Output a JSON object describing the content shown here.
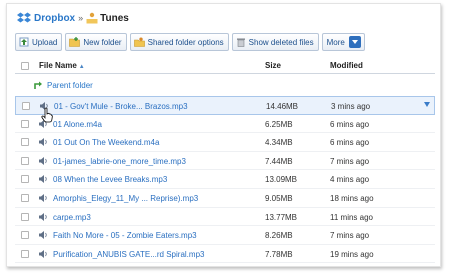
{
  "breadcrumb": {
    "root": "Dropbox",
    "separator": "»",
    "current": "Tunes"
  },
  "toolbar": {
    "upload": "Upload",
    "new_folder": "New folder",
    "shared_folder_options": "Shared folder options",
    "show_deleted_files": "Show deleted files",
    "more": "More"
  },
  "table": {
    "headers": {
      "name": "File Name",
      "size": "Size",
      "modified": "Modified"
    },
    "parent_folder": "Parent folder",
    "rows": [
      {
        "name": "01 - Gov't Mule - Broke... Brazos.mp3",
        "size": "14.46MB",
        "modified": "3 mins ago"
      },
      {
        "name": "01 Alone.m4a",
        "size": "6.25MB",
        "modified": "6 mins ago"
      },
      {
        "name": "01 Out On The Weekend.m4a",
        "size": "4.34MB",
        "modified": "6 mins ago"
      },
      {
        "name": "01-james_labrie-one_more_time.mp3",
        "size": "7.44MB",
        "modified": "7 mins ago"
      },
      {
        "name": "08 When the Levee Breaks.mp3",
        "size": "13.09MB",
        "modified": "4 mins ago"
      },
      {
        "name": "Amorphis_Elegy_11_My ... Reprise).mp3",
        "size": "9.05MB",
        "modified": "18 mins ago"
      },
      {
        "name": "carpe.mp3",
        "size": "13.77MB",
        "modified": "11 mins ago"
      },
      {
        "name": "Faith No More - 05 - Zombie Eaters.mp3",
        "size": "8.26MB",
        "modified": "7 mins ago"
      },
      {
        "name": "Purification_ANUBIS GATE...rd Spiral.mp3",
        "size": "7.78MB",
        "modified": "19 mins ago"
      }
    ]
  },
  "colors": {
    "link": "#2a6fc0",
    "accent": "#2f6fbd",
    "hover_row": "#eaf2fc"
  }
}
